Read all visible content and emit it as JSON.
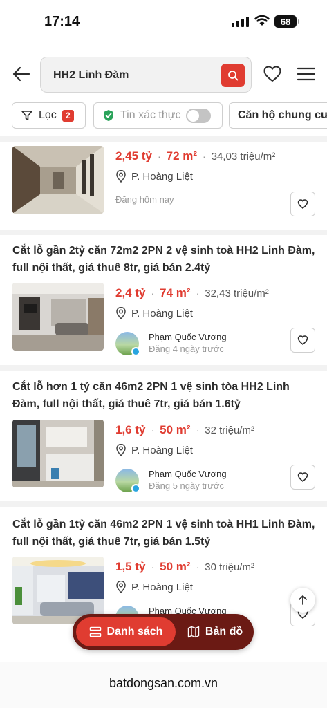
{
  "status_bar": {
    "time": "17:14",
    "battery": "68"
  },
  "header": {
    "search_value": "HH2 Linh Đàm"
  },
  "filters": {
    "filter_label": "Lọc",
    "filter_count": "2",
    "verified_label": "Tin xác thực",
    "type_label": "Căn hộ chung cư"
  },
  "listings": [
    {
      "title": "",
      "price": "2,45 tỷ",
      "area": "72 m²",
      "price_per_m2": "34,03 triệu/m²",
      "location": "P. Hoàng Liệt",
      "posted": "Đăng hôm nay"
    },
    {
      "title": "Cắt lỗ gần 2tỷ căn 72m2 2PN 2 vệ sinh toà HH2 Linh Đàm, full nội thất, giá thuê 8tr, giá bán 2.4tỷ",
      "price": "2,4 tỷ",
      "area": "74 m²",
      "price_per_m2": "32,43 triệu/m²",
      "location": "P. Hoàng Liệt",
      "agent_name": "Phạm Quốc Vương",
      "posted": "Đăng 4 ngày trước"
    },
    {
      "title": "Cắt lỗ hơn 1 tỷ căn 46m2 2PN 1 vệ sinh tòa HH2 Linh Đàm, full nội thất, giá thuê 7tr, giá bán 1.6tỷ",
      "price": "1,6 tỷ",
      "area": "50 m²",
      "price_per_m2": "32 triệu/m²",
      "location": "P. Hoàng Liệt",
      "agent_name": "Phạm Quốc Vương",
      "posted": "Đăng 5 ngày trước"
    },
    {
      "title": "Cắt lỗ gần 1tỷ căn 46m2 2PN 1 vệ sinh toà HH1 Linh Đàm, full nội thất, giá thuê 7tr, giá bán 1.5tỷ",
      "price": "1,5 tỷ",
      "area": "50 m²",
      "price_per_m2": "30 triệu/m²",
      "location": "P. Hoàng Liệt",
      "agent_name": "Phạm Quốc Vương"
    }
  ],
  "bottom_nav": {
    "list_label": "Danh sách",
    "map_label": "Bản đồ"
  },
  "browser": {
    "url": "batdongsan.com.vn"
  },
  "colors": {
    "accent": "#e03c31",
    "nav_dark": "#6b1a14"
  }
}
